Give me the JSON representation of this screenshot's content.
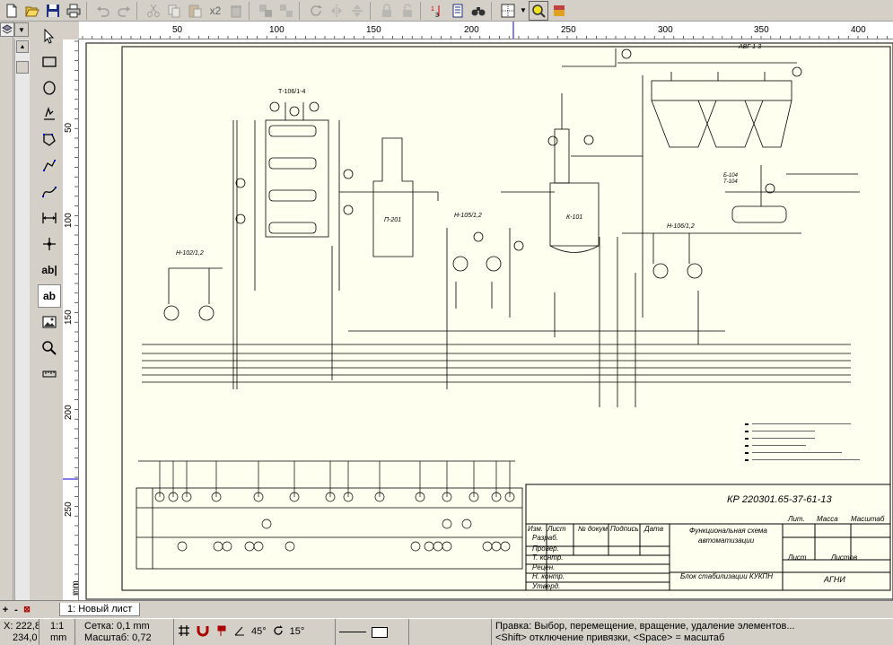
{
  "toolbar": {
    "undo_count_label": "x2",
    "accent_color": "#f0e020"
  },
  "ruler": {
    "h_ticks": [
      "50",
      "100",
      "150",
      "200",
      "250",
      "300",
      "350",
      "400"
    ],
    "v_ticks": [
      "50",
      "100",
      "150",
      "200",
      "250"
    ],
    "unit": "mm"
  },
  "drawing": {
    "stamp_code": "КР 220301.65-37-61-13",
    "stamp_title_1": "Функциональная схема",
    "stamp_title_2": "автоматизации",
    "stamp_subtitle": "Блок стабилизации КУКПН",
    "stamp_org": "АГНИ",
    "col_izm": "Изм.",
    "col_list": "Лист",
    "col_doc": "№ докум.",
    "col_sign": "Подпись",
    "col_date": "Дата",
    "row_razrab": "Разраб.",
    "row_prover": "Провер.",
    "row_tkontr": "Т. контр.",
    "row_recenz": "Рецен.",
    "row_nkontr": "Н. контр.",
    "row_utverd": "Утверд.",
    "lit": "Лит.",
    "massa": "Масса",
    "masshtab": "Масштаб",
    "list": "Лист",
    "listov": "Листов",
    "equipment": [
      "Т-106/1-4",
      "П-201",
      "Н-105/1,2",
      "К-101",
      "АВГ 1-3",
      "Б-104",
      "Т-104",
      "Н-106/1,2",
      "Н-102/1,2"
    ]
  },
  "tabbar": {
    "tab_label": "1: Новый лист"
  },
  "status": {
    "coord_x": "X: 222,8",
    "coord_y": "234,0",
    "scale_ratio": "1:1",
    "scale_unit": "mm",
    "grid_label": "Сетка: 0,1 mm",
    "zoom_label": "Масштаб:   0,72",
    "angle_1": "45°",
    "angle_2": "15°",
    "hint_line1": "Правка: Выбор, перемещение, вращение, удаление элементов...",
    "hint_line2": "<Shift> отключение привязки, <Space> = масштаб"
  }
}
